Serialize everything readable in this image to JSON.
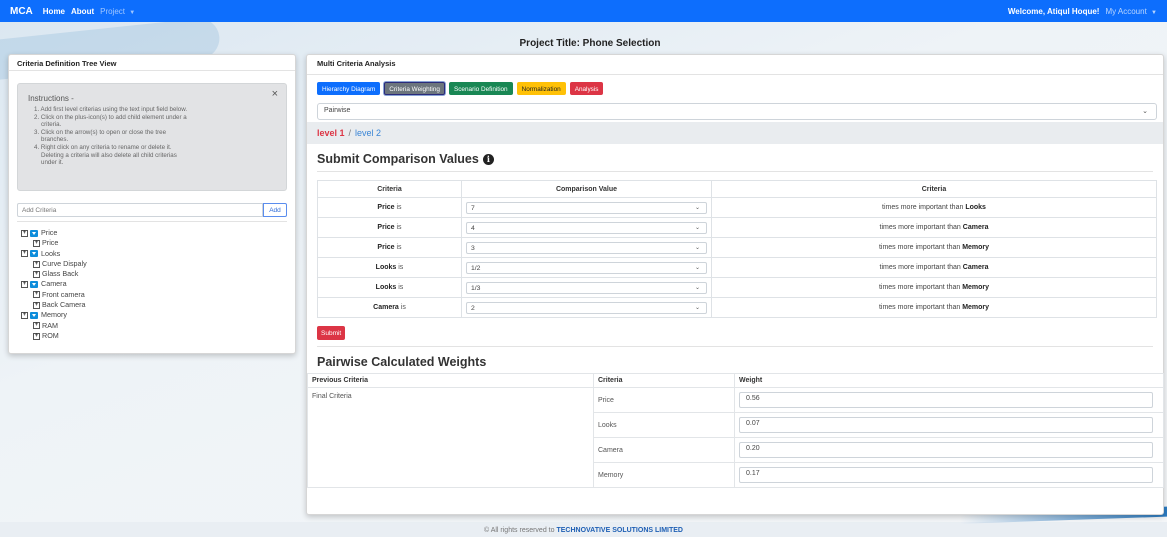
{
  "navbar": {
    "brand": "MCA",
    "links": [
      "Home",
      "About"
    ],
    "project_menu": "Project",
    "welcome": "Welcome, Atiqul Hoque!",
    "account_menu": "My Account"
  },
  "project_title": "Project Title: Phone Selection",
  "left_panel": {
    "title": "Criteria Definition Tree View",
    "instructions": {
      "title": "Instructions -",
      "close": "×",
      "lines": [
        "1. Add first level criterias using the text input field below.",
        "2. Click on the plus-icon(s) to add child element under a",
        "criteria.",
        "3. Click on the arrow(s) to open or close the tree",
        "branches.",
        "4. Right click on any criteria to rename or delete it.",
        "Deleting a criteria will also delete all child criterias",
        "under it."
      ]
    },
    "add_placeholder": "Add Criteria",
    "add_button": "Add",
    "tree": [
      {
        "label": "Price",
        "children": [
          "Price"
        ]
      },
      {
        "label": "Looks",
        "children": [
          "Curve Dispaly",
          "Glass Back"
        ]
      },
      {
        "label": "Camera",
        "children": [
          "Front camera",
          "Back Camera"
        ]
      },
      {
        "label": "Memory",
        "children": [
          "RAM",
          "ROM"
        ]
      }
    ]
  },
  "right_panel": {
    "title": "Multi Criteria Analysis",
    "tabs": {
      "hierarchy": "Hierarchy Diagram",
      "weighting": "Criteria Weighting",
      "scenario": "Scenario Definition",
      "normalization": "Normalization",
      "analysis": "Analysis"
    },
    "method_select": "Pairwise",
    "breadcrumb": {
      "active": "level 1",
      "sep": "/",
      "link": "level 2"
    },
    "comparison_title": "Submit Comparison Values",
    "comparison_headers": [
      "Criteria",
      "Comparison Value",
      "Criteria"
    ],
    "is_word": "is",
    "more_important": "times more important than",
    "rows": [
      {
        "left": "Price",
        "value": "7",
        "right": "Looks"
      },
      {
        "left": "Price",
        "value": "4",
        "right": "Camera"
      },
      {
        "left": "Price",
        "value": "3",
        "right": "Memory"
      },
      {
        "left": "Looks",
        "value": "1/2",
        "right": "Camera"
      },
      {
        "left": "Looks",
        "value": "1/3",
        "right": "Memory"
      },
      {
        "left": "Camera",
        "value": "2",
        "right": "Memory"
      }
    ],
    "submit": "Submit",
    "weights_title": "Pairwise Calculated Weights",
    "weights_headers": [
      "Previous Criteria",
      "Criteria",
      "Weight"
    ],
    "previous_criteria": "Final Criteria",
    "weights": [
      {
        "criteria": "Price",
        "weight": "0.56"
      },
      {
        "criteria": "Looks",
        "weight": "0.07"
      },
      {
        "criteria": "Camera",
        "weight": "0.20"
      },
      {
        "criteria": "Memory",
        "weight": "0.17"
      }
    ]
  },
  "footer": {
    "text": "© All rights reserved to",
    "company": "TECHNOVATIVE SOLUTIONS LIMITED"
  }
}
